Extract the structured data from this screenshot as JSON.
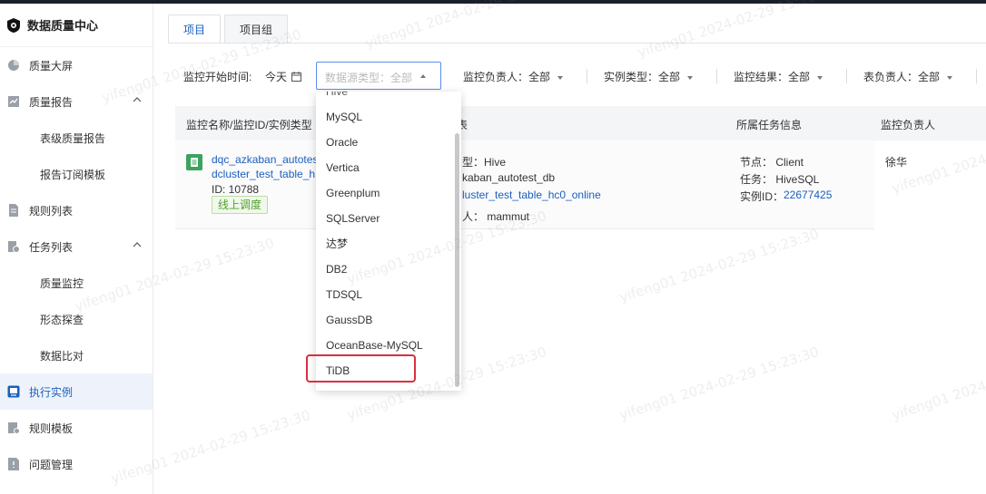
{
  "sidebar": {
    "app_title": "数据质量中心",
    "items": [
      {
        "label": "质量大屏"
      },
      {
        "label": "质量报告",
        "children": [
          "表级质量报告",
          "报告订阅模板"
        ]
      },
      {
        "label": "规则列表"
      },
      {
        "label": "任务列表",
        "children": [
          "质量监控",
          "形态探查",
          "数据比对"
        ]
      },
      {
        "label": "执行实例"
      },
      {
        "label": "规则模板"
      },
      {
        "label": "问题管理"
      }
    ]
  },
  "tabs": [
    "项目",
    "项目组"
  ],
  "filters": {
    "start_time_label": "监控开始时间:",
    "start_time_value": "今天",
    "datasource_placeholder": "数据源类型：全部",
    "owner": "监控负责人：全部",
    "instance_type": "实例类型：全部",
    "result": "监控结果：全部",
    "table_owner": "表负责人：全部"
  },
  "table": {
    "headers": [
      "监控名称/监控ID/实例类型",
      "表",
      "所属任务信息",
      "监控负责人"
    ],
    "row": {
      "name_line1": "dqc_azkaban_autotes",
      "name_line2": "dcluster_test_table_h",
      "id": "ID: 10788",
      "tag": "线上调度",
      "table_type": "型：Hive",
      "table_db": "kaban_autotest_db",
      "table_name": "luster_test_table_hc0_online",
      "table_owner": "人：  mammut",
      "node": "节点：  Client",
      "task": "任务：  HiveSQL",
      "instance_label": "实例ID：",
      "instance_id": "22677425",
      "monitor_owner": "徐华"
    }
  },
  "dropdown": {
    "partial_top": "Hive",
    "options": [
      "MySQL",
      "Oracle",
      "Vertica",
      "Greenplum",
      "SQLServer",
      "达梦",
      "DB2",
      "TDSQL",
      "GaussDB",
      "OceanBase-MySQL",
      "TiDB"
    ],
    "highlighted": "TiDB"
  },
  "watermark": "yifeng01 2024-02-29 15:23:30",
  "colors": {
    "accent": "#1b5fbf",
    "highlight_box": "#d9303e",
    "tag_green": "#52a02e"
  }
}
